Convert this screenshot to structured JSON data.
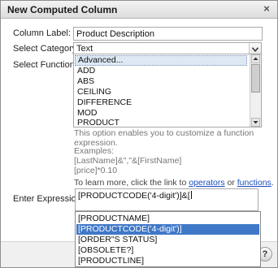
{
  "dialog": {
    "title": "New Computed Column",
    "close_glyph": "×"
  },
  "form": {
    "column_label": {
      "label": "Column Label:",
      "value": "Product Description"
    },
    "category": {
      "label": "Select Category:",
      "value": "Text"
    },
    "function": {
      "label": "Select Function:",
      "items": [
        "Advanced...",
        "ADD",
        "ABS",
        "CEILING",
        "DIFFERENCE",
        "MOD",
        "PRODUCT"
      ],
      "selected": "Advanced...",
      "description": "This option enables you to customize a function expression."
    },
    "examples": {
      "heading": "Examples:",
      "lines": [
        "[LastName]&\",\"&[FirstName]",
        "[price]*0.10"
      ]
    },
    "learn_more": {
      "prefix": "To learn more, click the link to ",
      "operators_link": "operators",
      "or_text": " or ",
      "functions_link": "functions",
      "suffix": "."
    },
    "expression": {
      "label": "Enter Expression:",
      "value": "[PRODUCTCODE('4-digit')]&["
    }
  },
  "autocomplete": {
    "items": [
      "[PRODUCTNAME]",
      "[PRODUCTCODE('4-digit')]",
      "[ORDER\"S STATUS]",
      "[OBSOLETE?]",
      "[PRODUCTLINE]"
    ],
    "selected": "[PRODUCTCODE('4-digit')]"
  },
  "footer": {
    "help_glyph": "?"
  }
}
